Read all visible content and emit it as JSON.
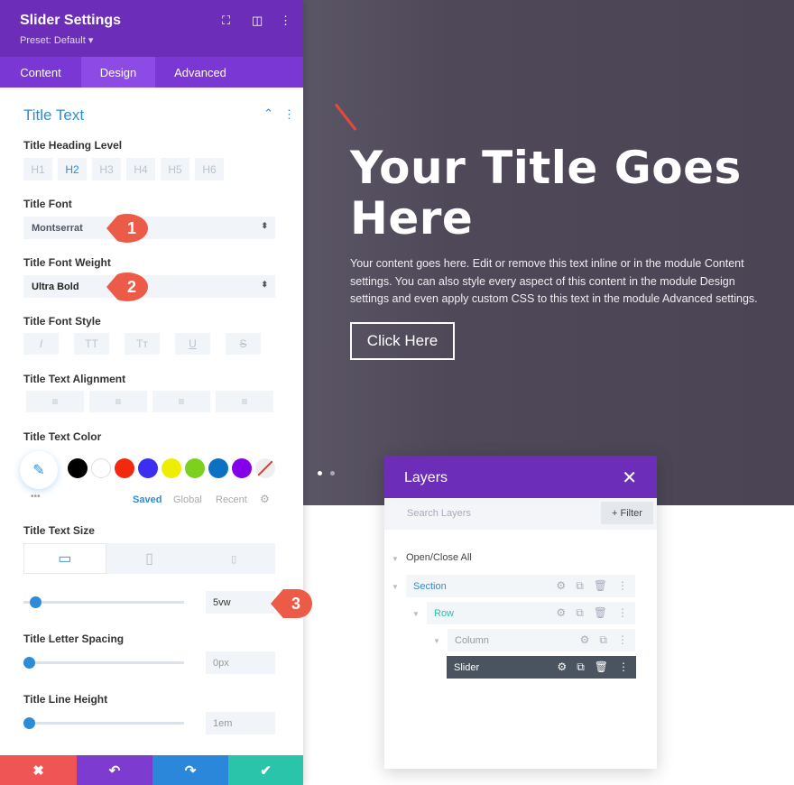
{
  "panel": {
    "title": "Slider Settings",
    "preset": "Preset: Default ▾",
    "tabs": [
      {
        "label": "Content"
      },
      {
        "label": "Design"
      },
      {
        "label": "Advanced"
      }
    ],
    "section": "Title Text",
    "heading_level": {
      "label": "Title Heading Level",
      "options": [
        "H1",
        "H2",
        "H3",
        "H4",
        "H5",
        "H6"
      ],
      "selected": "H2"
    },
    "font": {
      "label": "Title Font",
      "value": "Montserrat"
    },
    "weight": {
      "label": "Title Font Weight",
      "value": "Ultra Bold"
    },
    "style": {
      "label": "Title Font Style",
      "options": [
        "I",
        "TT",
        "Tт",
        "U",
        "S"
      ]
    },
    "alignment": {
      "label": "Title Text Alignment"
    },
    "color": {
      "label": "Title Text Color",
      "swatches": [
        "#000000",
        "#ffffff",
        "#f2280f",
        "#3c2ef0",
        "#eeee00",
        "#7cd11f",
        "#0c71c3",
        "#8300e9"
      ],
      "tabs": [
        "Saved",
        "Global",
        "Recent"
      ],
      "more": "•••"
    },
    "size": {
      "label": "Title Text Size",
      "value": "5vw",
      "slider": 0.05
    },
    "spacing": {
      "label": "Title Letter Spacing",
      "value": "0px"
    },
    "line_height": {
      "label": "Title Line Height",
      "value": "1em"
    },
    "badges": [
      "1",
      "2",
      "3"
    ],
    "bottom": {
      "cancel": "✖",
      "undo": "↶",
      "redo": "↷",
      "save": "✔"
    },
    "colors": {
      "header": "#6c2eb9",
      "accent": "#2e8cd6",
      "cancel": "#ef5555",
      "undo": "#7e3bd0",
      "redo": "#2b87da",
      "save": "#29c4a9"
    }
  },
  "hero": {
    "title": "Your Title Goes Here",
    "body": "Your content goes here. Edit or remove this text inline or in the module Content settings. You can also style every aspect of this content in the module Design settings and even apply custom CSS to this text in the module Advanced settings.",
    "button": "Click Here"
  },
  "layers": {
    "title": "Layers",
    "close": "✕",
    "search_placeholder": "Search Layers",
    "filter": "+ Filter",
    "toggle_all": "Open/Close All",
    "items": [
      {
        "label": "Section",
        "color": "#2e8cd6"
      },
      {
        "label": "Row",
        "color": "#29c4a9"
      },
      {
        "label": "Column",
        "color": "#999999"
      },
      {
        "label": "Slider",
        "color": "#ffffff"
      }
    ]
  }
}
